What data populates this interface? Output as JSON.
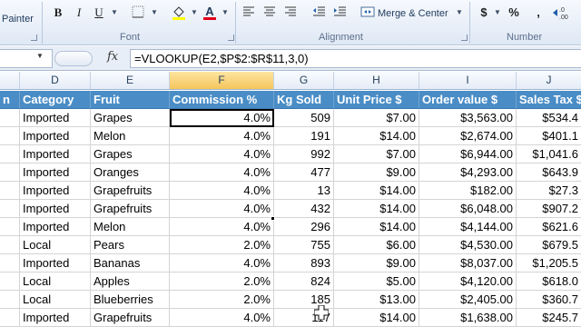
{
  "ribbon": {
    "painter_label": "Painter",
    "font_group": "Font",
    "alignment_group": "Alignment",
    "number_group": "Number",
    "merge_label": "Merge & Center",
    "bold": "B",
    "italic": "I",
    "underline": "U",
    "currency": "$",
    "percent": "%",
    "comma": ","
  },
  "formula_bar": {
    "name_box": "",
    "fx": "fx",
    "formula": "=VLOOKUP(E2,$P$2:$R$11,3,0)"
  },
  "columns": [
    {
      "letter": "D",
      "selected": false
    },
    {
      "letter": "E",
      "selected": false
    },
    {
      "letter": "F",
      "selected": true
    },
    {
      "letter": "G",
      "selected": false
    },
    {
      "letter": "H",
      "selected": false
    },
    {
      "letter": "I",
      "selected": false
    },
    {
      "letter": "J",
      "selected": false
    }
  ],
  "table": {
    "headers": [
      "n",
      "Category",
      "Fruit",
      "Commission %",
      "Kg Sold",
      "Unit Price $",
      "Order value $",
      "Sales Tax $"
    ],
    "rows": [
      [
        "Imported",
        "Grapes",
        "4.0%",
        "509",
        "$7.00",
        "$3,563.00",
        "$534.4"
      ],
      [
        "Imported",
        "Melon",
        "4.0%",
        "191",
        "$14.00",
        "$2,674.00",
        "$401.1"
      ],
      [
        "Imported",
        "Grapes",
        "4.0%",
        "992",
        "$7.00",
        "$6,944.00",
        "$1,041.6"
      ],
      [
        "Imported",
        "Oranges",
        "4.0%",
        "477",
        "$9.00",
        "$4,293.00",
        "$643.9"
      ],
      [
        "Imported",
        "Grapefruits",
        "4.0%",
        "13",
        "$14.00",
        "$182.00",
        "$27.3"
      ],
      [
        "Imported",
        "Grapefruits",
        "4.0%",
        "432",
        "$14.00",
        "$6,048.00",
        "$907.2"
      ],
      [
        "Imported",
        "Melon",
        "4.0%",
        "296",
        "$14.00",
        "$4,144.00",
        "$621.6"
      ],
      [
        "Local",
        "Pears",
        "2.0%",
        "755",
        "$6.00",
        "$4,530.00",
        "$679.5"
      ],
      [
        "Imported",
        "Bananas",
        "4.0%",
        "893",
        "$9.00",
        "$8,037.00",
        "$1,205.5"
      ],
      [
        "Local",
        "Apples",
        "2.0%",
        "824",
        "$5.00",
        "$4,120.00",
        "$618.0"
      ],
      [
        "Local",
        "Blueberries",
        "2.0%",
        "185",
        "$13.00",
        "$2,405.00",
        "$360.7"
      ],
      [
        "Imported",
        "Grapefruits",
        "4.0%",
        "117",
        "$14.00",
        "$1,638.00",
        "$245.7"
      ]
    ]
  },
  "colors": {
    "header_fill": "#4a8dc6",
    "selected_column": "#f5c55b"
  }
}
